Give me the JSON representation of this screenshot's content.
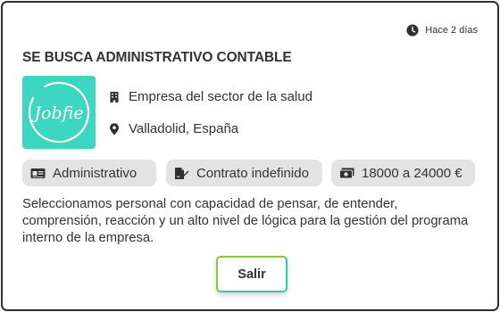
{
  "posted": {
    "icon": "clock-icon",
    "text": "Hace 2 días"
  },
  "job": {
    "title": "SE BUSCA ADMINISTRATIVO CONTABLE",
    "logo_text": "Jobfie",
    "brand_color": "#3dd6c0",
    "company": {
      "icon": "building-icon",
      "text": "Empresa del sector de la salud"
    },
    "location": {
      "icon": "location-pin-icon",
      "text": "Valladolid, España"
    },
    "tags": [
      {
        "icon": "id-card-icon",
        "text": "Administrativo"
      },
      {
        "icon": "contract-sign-icon",
        "text": "Contrato indefinido"
      },
      {
        "icon": "money-icon",
        "text": "18000 a 24000 €"
      }
    ],
    "description": "Seleccionamos personal con capacidad de pensar, de entender, comprensión, reacción y un alto nivel de lógica para la gestión del programa interno de la empresa."
  },
  "actions": {
    "exit_label": "Salir"
  }
}
